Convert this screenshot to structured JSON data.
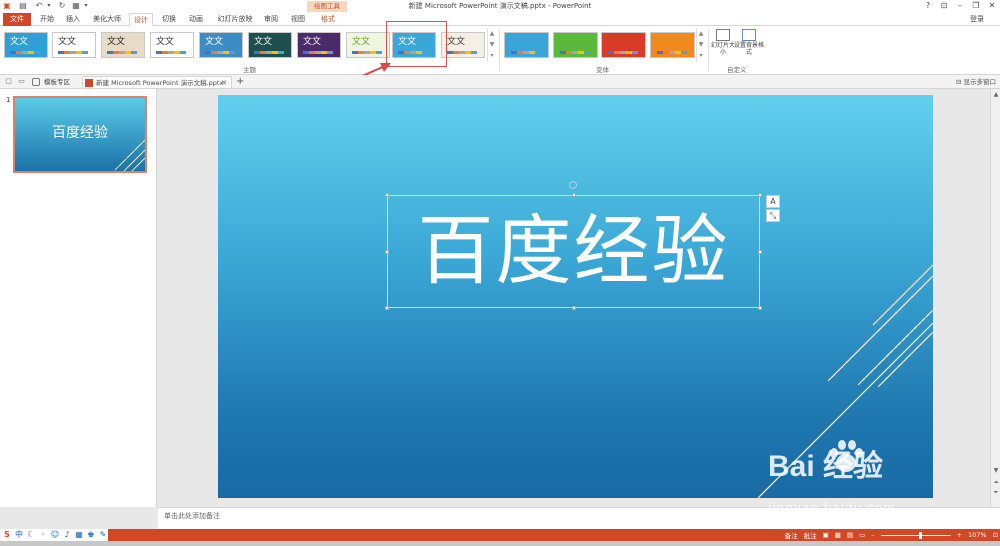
{
  "app": {
    "window_title": "新建 Microsoft PowerPoint 演示文稿.pptx - PowerPoint",
    "login": "登录",
    "context_tab_group": "绘图工具"
  },
  "ribbon_tabs": [
    {
      "label": "文件",
      "active": false
    },
    {
      "label": "开始",
      "active": false
    },
    {
      "label": "插入",
      "active": false
    },
    {
      "label": "美化大师",
      "active": false
    },
    {
      "label": "设计",
      "active": true
    },
    {
      "label": "切换",
      "active": false
    },
    {
      "label": "动画",
      "active": false
    },
    {
      "label": "幻灯片放映",
      "active": false
    },
    {
      "label": "审阅",
      "active": false
    },
    {
      "label": "视图",
      "active": false
    },
    {
      "label": "格式",
      "active": false
    }
  ],
  "themes_group": {
    "label": "主题",
    "themes": [
      {
        "text": "文文",
        "bg": "#2f9fd8",
        "fg": "#ffffff"
      },
      {
        "text": "文文",
        "bg": "#ffffff",
        "fg": "#333333"
      },
      {
        "text": "文文",
        "bg": "#e8dcc8",
        "fg": "#222222"
      },
      {
        "text": "文文",
        "bg": "#ffffff",
        "fg": "#333333"
      },
      {
        "text": "文文",
        "bg": "#3d8cc4",
        "fg": "#ffffff"
      },
      {
        "text": "文文",
        "bg": "#1e4f4f",
        "fg": "#ffffff"
      },
      {
        "text": "文文",
        "bg": "#4a2a6a",
        "fg": "#ffffff"
      },
      {
        "text": "文文",
        "bg": "#eef5e0",
        "fg": "#6aa329"
      },
      {
        "text": "文文",
        "bg": "#39a8d6",
        "fg": "#ffffff"
      },
      {
        "text": "文文",
        "bg": "#f4f0e4",
        "fg": "#333333"
      }
    ]
  },
  "variants_group": {
    "label": "变体",
    "variants": [
      "#3aa6d8",
      "#5cb83c",
      "#d83a2a",
      "#f08a1c"
    ]
  },
  "customize_group": {
    "label": "自定义",
    "slide_size": "幻灯片大小",
    "format_background": "设置背景格式"
  },
  "doc_tabs": {
    "template_tab": "模板专区",
    "doc_tab": "新建 Microsoft PowerPoint 演示文稿.pptx",
    "show_multi_window": "显示多窗口"
  },
  "thumbnail": {
    "number": "1",
    "title": "百度经验"
  },
  "slide": {
    "title": "百度经验"
  },
  "format_buttons": {
    "a": "A"
  },
  "notes_placeholder": "单击此处添加备注",
  "status": {
    "notes": "备注",
    "comments": "批注",
    "zoom": "107%"
  },
  "watermark": {
    "logo": "Bai  经验",
    "url": "jingyan.baidu.com"
  }
}
